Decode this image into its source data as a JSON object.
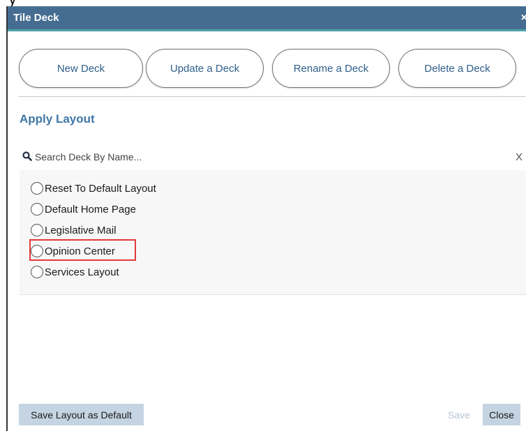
{
  "dialog": {
    "title": "Tile Deck",
    "close_glyph": "×",
    "top_fragment": "y"
  },
  "actions": {
    "new_deck": "New Deck",
    "update_deck": "Update a Deck",
    "rename_deck": "Rename a Deck",
    "delete_deck": "Delete a Deck"
  },
  "apply_layout": {
    "heading": "Apply Layout",
    "search_placeholder": "Search Deck By Name...",
    "search_value": "",
    "clear_label": "X",
    "options": [
      {
        "label": "Reset To Default Layout",
        "selected": false
      },
      {
        "label": "Default Home Page",
        "selected": false
      },
      {
        "label": "Legislative Mail",
        "selected": false
      },
      {
        "label": "Opinion Center",
        "selected": false
      },
      {
        "label": "Services Layout",
        "selected": false
      }
    ]
  },
  "footer": {
    "save_default": "Save Layout as Default",
    "save": "Save",
    "close": "Close"
  },
  "colors": {
    "titlebar": "#456d91",
    "accent_line": "#4da3a6",
    "heading": "#3f76a8",
    "highlight": "#e03a3a"
  },
  "icons": {
    "search": "search-icon",
    "close": "close-icon"
  }
}
